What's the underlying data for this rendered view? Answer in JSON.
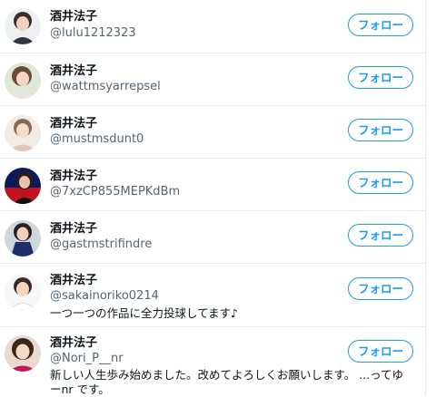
{
  "users": [
    {
      "name": "酒井法子",
      "handle": "@lulu1212323",
      "bio": "",
      "follow_label": "フォロー"
    },
    {
      "name": "酒井法子",
      "handle": "@wattmsyarrepsel",
      "bio": "",
      "follow_label": "フォロー"
    },
    {
      "name": "酒井法子",
      "handle": "@mustmsdunt0",
      "bio": "",
      "follow_label": "フォロー"
    },
    {
      "name": "酒井法子",
      "handle": "@7xzCP855MEPKdBm",
      "bio": "",
      "follow_label": "フォロー"
    },
    {
      "name": "酒井法子",
      "handle": "@gastmstrifindre",
      "bio": "",
      "follow_label": "フォロー"
    },
    {
      "name": "酒井法子",
      "handle": "@sakainoriko0214",
      "bio": "一つ一つの作品に全力投球してます♪",
      "follow_label": "フォロー"
    },
    {
      "name": "酒井法子",
      "handle": "@Nori_P__nr",
      "bio": "新しい人生歩み始めました。改めてよろしくお願いします。 ...ってゆーnr です。",
      "follow_label": "フォロー"
    }
  ],
  "colors": {
    "accent": "#1d9bf0",
    "handle_text": "#536471",
    "divider": "#e6ecf0"
  }
}
